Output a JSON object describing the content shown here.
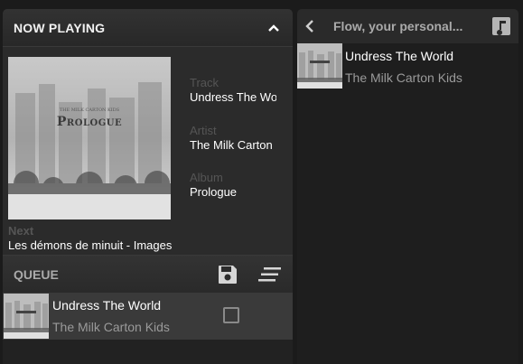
{
  "now_playing": {
    "header": "NOW PLAYING",
    "track_label": "Track",
    "track": "Undress The World",
    "artist_label": "Artist",
    "artist": "The Milk Carton Kids",
    "album_label": "Album",
    "album": "Prologue",
    "cover_text": "Prologue",
    "cover_subtext": "The Milk Carton Kids",
    "next_label": "Next",
    "next_value": "Les démons de minuit - Images"
  },
  "queue": {
    "header": "QUEUE",
    "items": [
      {
        "title": "Undress The World",
        "artist": "The Milk Carton Kids",
        "checked": false
      }
    ]
  },
  "flow": {
    "title": "Flow, your personal...",
    "items": [
      {
        "title": "Undress The World",
        "artist": "The Milk Carton Kids"
      }
    ]
  },
  "colors": {
    "bg": "#1b1b1b",
    "panel": "#2b2b2b",
    "row": "#3a3a3a"
  },
  "icons": [
    "chevron-up-icon",
    "save-icon",
    "list-icon",
    "back-arrow-icon",
    "music-note-icon"
  ]
}
